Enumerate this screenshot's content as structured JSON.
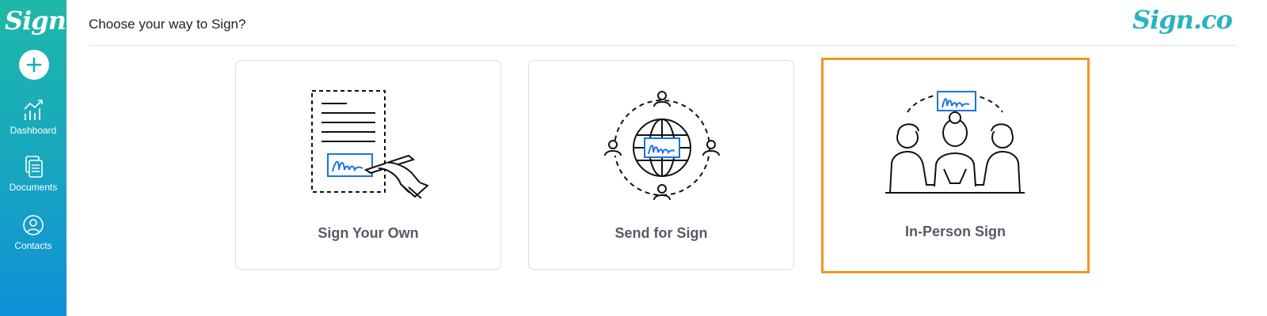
{
  "app": {
    "sidebar_logo": "Sign",
    "brand_logo": "Sign.co"
  },
  "sidebar": {
    "add_button_symbol": "+",
    "items": [
      {
        "label": "Dashboard",
        "icon": "chart-icon"
      },
      {
        "label": "Documents",
        "icon": "documents-icon"
      },
      {
        "label": "Contacts",
        "icon": "user-icon"
      }
    ]
  },
  "header": {
    "title": "Choose your way to Sign?"
  },
  "cards": [
    {
      "label": "Sign Your Own",
      "icon": "sign-document-icon",
      "selected": false
    },
    {
      "label": "Send for Sign",
      "icon": "send-globe-icon",
      "selected": false
    },
    {
      "label": "In-Person Sign",
      "icon": "in-person-icon",
      "selected": true
    }
  ],
  "colors": {
    "sidebar_gradient_top": "#1eb8a8",
    "sidebar_gradient_bottom": "#0f8fd8",
    "brand": "#29b3bf",
    "selected_border": "#f7941d",
    "signature_blue": "#1a73e8",
    "label_text": "#555b66"
  }
}
